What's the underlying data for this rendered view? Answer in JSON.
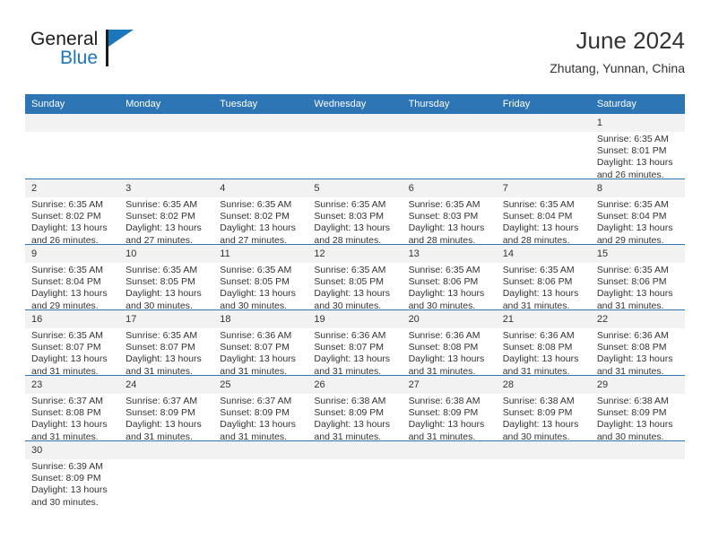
{
  "brand": {
    "name_top": "General",
    "name_bottom": "Blue",
    "accent_color": "#1b76bc"
  },
  "header": {
    "title": "June 2024",
    "subtitle": "Zhutang, Yunnan, China"
  },
  "theme": {
    "header_blue": "#2e75b6",
    "daynum_band": "#f2f2f2",
    "text": "#333333"
  },
  "weekdays": [
    "Sunday",
    "Monday",
    "Tuesday",
    "Wednesday",
    "Thursday",
    "Friday",
    "Saturday"
  ],
  "labels": {
    "sunrise_prefix": "Sunrise:",
    "sunset_prefix": "Sunset:",
    "daylight_prefix": "Daylight:"
  },
  "weeks": [
    [
      {
        "blank": true
      },
      {
        "blank": true
      },
      {
        "blank": true
      },
      {
        "blank": true
      },
      {
        "blank": true
      },
      {
        "blank": true
      },
      {
        "day": "1",
        "sunrise": "Sunrise: 6:35 AM",
        "sunset": "Sunset: 8:01 PM",
        "daylight1": "Daylight: 13 hours",
        "daylight2": "and 26 minutes."
      }
    ],
    [
      {
        "day": "2",
        "sunrise": "Sunrise: 6:35 AM",
        "sunset": "Sunset: 8:02 PM",
        "daylight1": "Daylight: 13 hours",
        "daylight2": "and 26 minutes."
      },
      {
        "day": "3",
        "sunrise": "Sunrise: 6:35 AM",
        "sunset": "Sunset: 8:02 PM",
        "daylight1": "Daylight: 13 hours",
        "daylight2": "and 27 minutes."
      },
      {
        "day": "4",
        "sunrise": "Sunrise: 6:35 AM",
        "sunset": "Sunset: 8:02 PM",
        "daylight1": "Daylight: 13 hours",
        "daylight2": "and 27 minutes."
      },
      {
        "day": "5",
        "sunrise": "Sunrise: 6:35 AM",
        "sunset": "Sunset: 8:03 PM",
        "daylight1": "Daylight: 13 hours",
        "daylight2": "and 28 minutes."
      },
      {
        "day": "6",
        "sunrise": "Sunrise: 6:35 AM",
        "sunset": "Sunset: 8:03 PM",
        "daylight1": "Daylight: 13 hours",
        "daylight2": "and 28 minutes."
      },
      {
        "day": "7",
        "sunrise": "Sunrise: 6:35 AM",
        "sunset": "Sunset: 8:04 PM",
        "daylight1": "Daylight: 13 hours",
        "daylight2": "and 28 minutes."
      },
      {
        "day": "8",
        "sunrise": "Sunrise: 6:35 AM",
        "sunset": "Sunset: 8:04 PM",
        "daylight1": "Daylight: 13 hours",
        "daylight2": "and 29 minutes."
      }
    ],
    [
      {
        "day": "9",
        "sunrise": "Sunrise: 6:35 AM",
        "sunset": "Sunset: 8:04 PM",
        "daylight1": "Daylight: 13 hours",
        "daylight2": "and 29 minutes."
      },
      {
        "day": "10",
        "sunrise": "Sunrise: 6:35 AM",
        "sunset": "Sunset: 8:05 PM",
        "daylight1": "Daylight: 13 hours",
        "daylight2": "and 30 minutes."
      },
      {
        "day": "11",
        "sunrise": "Sunrise: 6:35 AM",
        "sunset": "Sunset: 8:05 PM",
        "daylight1": "Daylight: 13 hours",
        "daylight2": "and 30 minutes."
      },
      {
        "day": "12",
        "sunrise": "Sunrise: 6:35 AM",
        "sunset": "Sunset: 8:05 PM",
        "daylight1": "Daylight: 13 hours",
        "daylight2": "and 30 minutes."
      },
      {
        "day": "13",
        "sunrise": "Sunrise: 6:35 AM",
        "sunset": "Sunset: 8:06 PM",
        "daylight1": "Daylight: 13 hours",
        "daylight2": "and 30 minutes."
      },
      {
        "day": "14",
        "sunrise": "Sunrise: 6:35 AM",
        "sunset": "Sunset: 8:06 PM",
        "daylight1": "Daylight: 13 hours",
        "daylight2": "and 31 minutes."
      },
      {
        "day": "15",
        "sunrise": "Sunrise: 6:35 AM",
        "sunset": "Sunset: 8:06 PM",
        "daylight1": "Daylight: 13 hours",
        "daylight2": "and 31 minutes."
      }
    ],
    [
      {
        "day": "16",
        "sunrise": "Sunrise: 6:35 AM",
        "sunset": "Sunset: 8:07 PM",
        "daylight1": "Daylight: 13 hours",
        "daylight2": "and 31 minutes."
      },
      {
        "day": "17",
        "sunrise": "Sunrise: 6:35 AM",
        "sunset": "Sunset: 8:07 PM",
        "daylight1": "Daylight: 13 hours",
        "daylight2": "and 31 minutes."
      },
      {
        "day": "18",
        "sunrise": "Sunrise: 6:36 AM",
        "sunset": "Sunset: 8:07 PM",
        "daylight1": "Daylight: 13 hours",
        "daylight2": "and 31 minutes."
      },
      {
        "day": "19",
        "sunrise": "Sunrise: 6:36 AM",
        "sunset": "Sunset: 8:07 PM",
        "daylight1": "Daylight: 13 hours",
        "daylight2": "and 31 minutes."
      },
      {
        "day": "20",
        "sunrise": "Sunrise: 6:36 AM",
        "sunset": "Sunset: 8:08 PM",
        "daylight1": "Daylight: 13 hours",
        "daylight2": "and 31 minutes."
      },
      {
        "day": "21",
        "sunrise": "Sunrise: 6:36 AM",
        "sunset": "Sunset: 8:08 PM",
        "daylight1": "Daylight: 13 hours",
        "daylight2": "and 31 minutes."
      },
      {
        "day": "22",
        "sunrise": "Sunrise: 6:36 AM",
        "sunset": "Sunset: 8:08 PM",
        "daylight1": "Daylight: 13 hours",
        "daylight2": "and 31 minutes."
      }
    ],
    [
      {
        "day": "23",
        "sunrise": "Sunrise: 6:37 AM",
        "sunset": "Sunset: 8:08 PM",
        "daylight1": "Daylight: 13 hours",
        "daylight2": "and 31 minutes."
      },
      {
        "day": "24",
        "sunrise": "Sunrise: 6:37 AM",
        "sunset": "Sunset: 8:09 PM",
        "daylight1": "Daylight: 13 hours",
        "daylight2": "and 31 minutes."
      },
      {
        "day": "25",
        "sunrise": "Sunrise: 6:37 AM",
        "sunset": "Sunset: 8:09 PM",
        "daylight1": "Daylight: 13 hours",
        "daylight2": "and 31 minutes."
      },
      {
        "day": "26",
        "sunrise": "Sunrise: 6:38 AM",
        "sunset": "Sunset: 8:09 PM",
        "daylight1": "Daylight: 13 hours",
        "daylight2": "and 31 minutes."
      },
      {
        "day": "27",
        "sunrise": "Sunrise: 6:38 AM",
        "sunset": "Sunset: 8:09 PM",
        "daylight1": "Daylight: 13 hours",
        "daylight2": "and 31 minutes."
      },
      {
        "day": "28",
        "sunrise": "Sunrise: 6:38 AM",
        "sunset": "Sunset: 8:09 PM",
        "daylight1": "Daylight: 13 hours",
        "daylight2": "and 30 minutes."
      },
      {
        "day": "29",
        "sunrise": "Sunrise: 6:38 AM",
        "sunset": "Sunset: 8:09 PM",
        "daylight1": "Daylight: 13 hours",
        "daylight2": "and 30 minutes."
      }
    ],
    [
      {
        "day": "30",
        "sunrise": "Sunrise: 6:39 AM",
        "sunset": "Sunset: 8:09 PM",
        "daylight1": "Daylight: 13 hours",
        "daylight2": "and 30 minutes."
      },
      {
        "blank": true
      },
      {
        "blank": true
      },
      {
        "blank": true
      },
      {
        "blank": true
      },
      {
        "blank": true
      },
      {
        "blank": true
      }
    ]
  ]
}
